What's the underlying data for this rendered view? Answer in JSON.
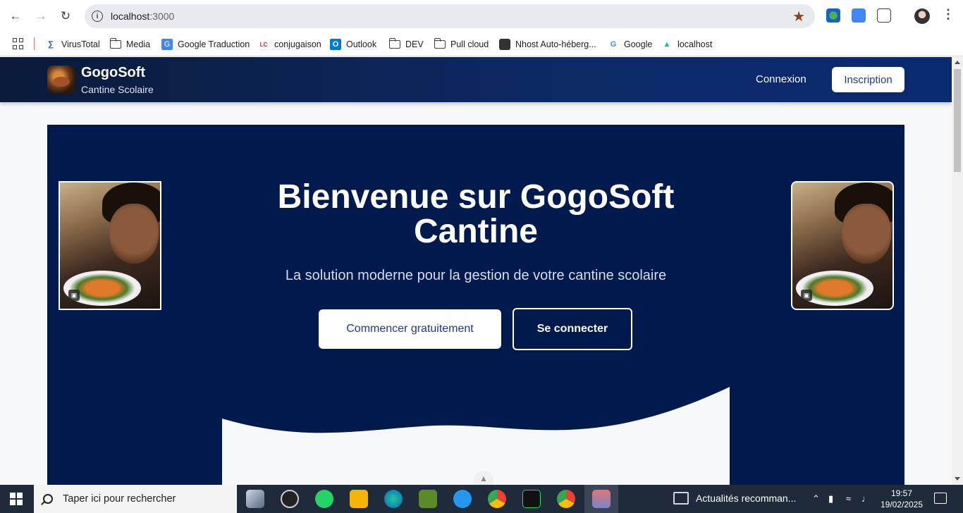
{
  "browser": {
    "url_host": "localhost",
    "url_port": ":3000",
    "bookmarks": [
      {
        "label": "VirusTotal",
        "icon": "virustotal-icon"
      },
      {
        "label": "Media",
        "icon": "folder-icon"
      },
      {
        "label": "Google Traduction",
        "icon": "google-translate-icon"
      },
      {
        "label": "conjugaison",
        "icon": "conjugaison-icon"
      },
      {
        "label": "Outlook",
        "icon": "outlook-icon"
      },
      {
        "label": "DEV",
        "icon": "folder-icon"
      },
      {
        "label": "Pull cloud",
        "icon": "folder-icon"
      },
      {
        "label": "Nhost Auto-héberg...",
        "icon": "nhost-icon"
      },
      {
        "label": "Google",
        "icon": "google-icon"
      },
      {
        "label": "localhost",
        "icon": "nuxt-icon"
      }
    ]
  },
  "header": {
    "brand_title": "GogoSoft",
    "brand_subtitle": "Cantine Scolaire",
    "login_label": "Connexion",
    "signup_label": "Inscription"
  },
  "hero": {
    "title": "Bienvenue sur GogoSoft Cantine",
    "subtitle": "La solution moderne pour la gestion de votre cantine scolaire",
    "primary_cta": "Commencer gratuitement",
    "secondary_cta": "Se connecter"
  },
  "taskbar": {
    "search_placeholder": "Taper ici pour rechercher",
    "news_label": "Actualités recomman...",
    "time": "19:57",
    "date": "19/02/2025"
  },
  "colors": {
    "header_dark": "#0a1a3a",
    "hero_bg": "#001a4d",
    "accent": "#1e3a8a"
  }
}
